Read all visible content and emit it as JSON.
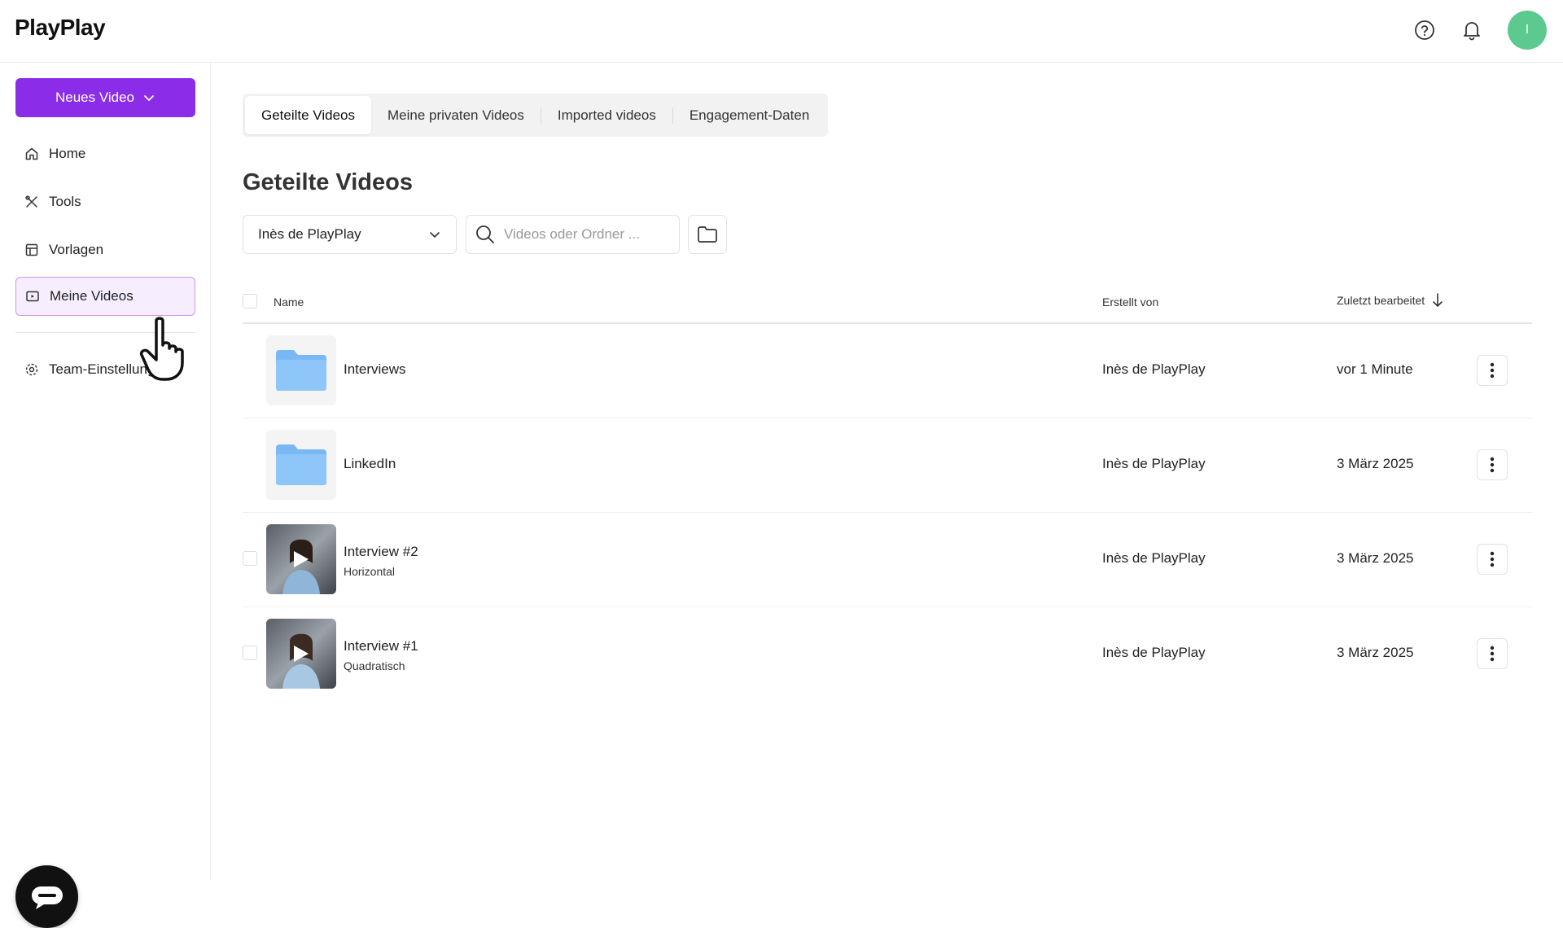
{
  "header": {
    "logo": "PlayPlay",
    "avatar_initial": "I",
    "avatar_color": "#5cc98f",
    "icons": [
      "help-icon",
      "bell-icon"
    ]
  },
  "sidebar": {
    "new_video_label": "Neues Video",
    "accent_color": "#8b2de8",
    "items": [
      {
        "label": "Home",
        "icon": "home-icon"
      },
      {
        "label": "Tools",
        "icon": "tools-icon"
      },
      {
        "label": "Vorlagen",
        "icon": "template-icon"
      },
      {
        "label": "Meine Videos",
        "icon": "video-icon",
        "active": true
      },
      {
        "label": "Team-Einstellungen",
        "icon": "gear-icon"
      }
    ]
  },
  "tabs": [
    {
      "label": "Geteilte Videos",
      "active": true
    },
    {
      "label": "Meine privaten Videos"
    },
    {
      "label": "Imported videos"
    },
    {
      "label": "Engagement-Daten"
    }
  ],
  "page": {
    "title": "Geteilte Videos",
    "filter_value": "Inès de PlayPlay",
    "search_placeholder": "Videos oder Ordner ..."
  },
  "table": {
    "columns": {
      "name": "Name",
      "created_by": "Erstellt von",
      "last_edited": "Zuletzt bearbeitet"
    },
    "rows": [
      {
        "type": "folder",
        "title": "Interviews",
        "subtitle": "",
        "created_by": "Inès de PlayPlay",
        "last_edited": "vor 1 Minute"
      },
      {
        "type": "folder",
        "title": "LinkedIn",
        "subtitle": "",
        "created_by": "Inès de PlayPlay",
        "last_edited": "3 März 2025"
      },
      {
        "type": "video",
        "title": "Interview #2",
        "subtitle": "Horizontal",
        "created_by": "Inès de PlayPlay",
        "last_edited": "3 März 2025"
      },
      {
        "type": "video",
        "title": "Interview #1",
        "subtitle": "Quadratisch",
        "created_by": "Inès de PlayPlay",
        "last_edited": "3 März 2025"
      }
    ]
  }
}
